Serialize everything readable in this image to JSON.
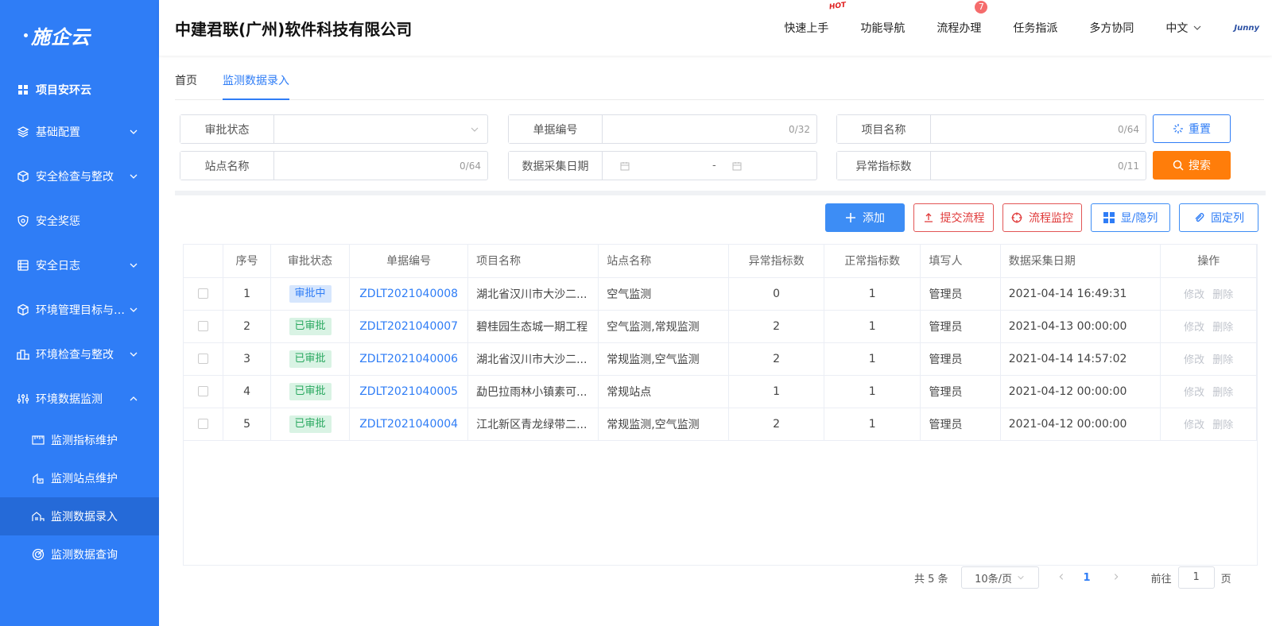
{
  "brand": {
    "logo_text": "施企云",
    "company": "中建君联(广州)软件科技有限公司",
    "corner_logo": "Junny"
  },
  "header_nav": {
    "items": [
      {
        "label": "快速上手",
        "tag": "HOT"
      },
      {
        "label": "功能导航"
      },
      {
        "label": "流程办理",
        "badge": "7"
      },
      {
        "label": "任务指派"
      },
      {
        "label": "多方协同"
      }
    ],
    "language": "中文"
  },
  "sidebar": {
    "title": "项目安环云",
    "items": [
      {
        "label": "基础配置",
        "icon": "layers-icon"
      },
      {
        "label": "安全检查与整改",
        "icon": "cube-icon"
      },
      {
        "label": "安全奖惩",
        "icon": "shield-icon"
      },
      {
        "label": "安全日志",
        "icon": "log-icon"
      },
      {
        "label": "环境管理目标与考核",
        "icon": "target-cube-icon"
      },
      {
        "label": "环境检查与整改",
        "icon": "env-check-icon"
      },
      {
        "label": "环境数据监测",
        "icon": "sliders-icon"
      }
    ],
    "sub_items": [
      {
        "label": "监测指标维护"
      },
      {
        "label": "监测站点维护"
      },
      {
        "label": "监测数据录入"
      },
      {
        "label": "监测数据查询"
      }
    ]
  },
  "tabs": [
    "首页",
    "监测数据录入"
  ],
  "filters": {
    "approval_status": {
      "label": "审批状态",
      "value": ""
    },
    "doc_no": {
      "label": "单据编号",
      "counter": "0/32"
    },
    "project_name": {
      "label": "项目名称",
      "counter": "0/64"
    },
    "site_name": {
      "label": "站点名称",
      "counter": "0/64"
    },
    "collect_date": {
      "label": "数据采集日期",
      "sep": "-"
    },
    "abnormal_count": {
      "label": "异常指标数",
      "counter": "0/11"
    },
    "reset_label": "重置",
    "search_label": "搜索"
  },
  "toolbar": {
    "add": "添加",
    "submit_flow": "提交流程",
    "flow_monitor": "流程监控",
    "show_hide_cols": "显/隐列",
    "fix_cols": "固定列"
  },
  "table": {
    "headers": [
      "序号",
      "审批状态",
      "单据编号",
      "项目名称",
      "站点名称",
      "异常指标数",
      "正常指标数",
      "填写人",
      "数据采集日期",
      "操作"
    ],
    "rows": [
      {
        "no": "1",
        "status": "审批中",
        "status_kind": "pending",
        "doc": "ZDLT2021040008",
        "project": "湖北省汉川市大沙二...",
        "site": "空气监测",
        "abnormal": "0",
        "normal": "1",
        "author": "管理员",
        "date": "2021-04-14 16:49:31",
        "edit": "修改",
        "del": "删除"
      },
      {
        "no": "2",
        "status": "已审批",
        "status_kind": "done",
        "doc": "ZDLT2021040007",
        "project": "碧桂园生态城一期工程",
        "site": "空气监测,常规监测",
        "abnormal": "2",
        "normal": "1",
        "author": "管理员",
        "date": "2021-04-13 00:00:00",
        "edit": "修改",
        "del": "删除"
      },
      {
        "no": "3",
        "status": "已审批",
        "status_kind": "done",
        "doc": "ZDLT2021040006",
        "project": "湖北省汉川市大沙二...",
        "site": "常规监测,空气监测",
        "abnormal": "2",
        "normal": "1",
        "author": "管理员",
        "date": "2021-04-14 14:57:02",
        "edit": "修改",
        "del": "删除"
      },
      {
        "no": "4",
        "status": "已审批",
        "status_kind": "done",
        "doc": "ZDLT2021040005",
        "project": "勐巴拉雨林小镇素可...",
        "site": "常规站点",
        "abnormal": "1",
        "normal": "1",
        "author": "管理员",
        "date": "2021-04-12 00:00:00",
        "edit": "修改",
        "del": "删除"
      },
      {
        "no": "5",
        "status": "已审批",
        "status_kind": "done",
        "doc": "ZDLT2021040004",
        "project": "江北新区青龙绿带二...",
        "site": "常规监测,空气监测",
        "abnormal": "2",
        "normal": "1",
        "author": "管理员",
        "date": "2021-04-12 00:00:00",
        "edit": "修改",
        "del": "删除"
      }
    ]
  },
  "pagination": {
    "total": "共 5 条",
    "page_size": "10条/页",
    "current": "1",
    "goto_label": "前往",
    "goto_value": "1",
    "page_unit": "页"
  }
}
